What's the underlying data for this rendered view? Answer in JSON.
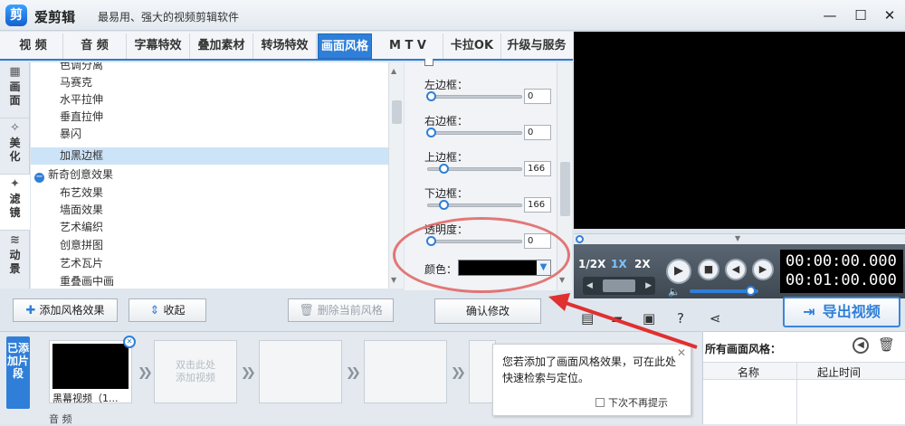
{
  "app": {
    "name": "爱剪辑",
    "slogan": "最易用、强大的视频剪辑软件"
  },
  "window_controls": {
    "minimize": "—",
    "maximize": "☐",
    "close": "✕"
  },
  "tabs": [
    {
      "label": "视 频"
    },
    {
      "label": "音 频"
    },
    {
      "label": "字幕特效"
    },
    {
      "label": "叠加素材"
    },
    {
      "label": "转场特效"
    },
    {
      "label": "画面风格",
      "active": true
    },
    {
      "label": "M T V"
    },
    {
      "label": "卡拉OK"
    },
    {
      "label": "升级与服务"
    }
  ],
  "side_tabs": [
    {
      "label": "画面",
      "icon": "picture-icon"
    },
    {
      "label": "美化",
      "icon": "magic-wand-icon"
    },
    {
      "label": "滤镜",
      "icon": "filter-icon",
      "active": true
    },
    {
      "label": "动景",
      "icon": "motion-icon"
    }
  ],
  "effect_list": [
    {
      "label": "色调分离",
      "type": "child"
    },
    {
      "label": "马赛克",
      "type": "child"
    },
    {
      "label": "水平拉伸",
      "type": "child"
    },
    {
      "label": "垂直拉伸",
      "type": "child"
    },
    {
      "label": "暴闪",
      "type": "child"
    },
    {
      "label": "加黑边框",
      "type": "child",
      "selected": true
    },
    {
      "label": "新奇创意效果",
      "type": "group"
    },
    {
      "label": "布艺效果",
      "type": "child"
    },
    {
      "label": "墙面效果",
      "type": "child"
    },
    {
      "label": "艺术编织",
      "type": "child"
    },
    {
      "label": "创意拼图",
      "type": "child"
    },
    {
      "label": "艺术瓦片",
      "type": "child"
    },
    {
      "label": "重叠画中画",
      "type": "child"
    }
  ],
  "settings": {
    "sliders": [
      {
        "label": "左边框：",
        "value": "0",
        "level": 0
      },
      {
        "label": "右边框：",
        "value": "0",
        "level": 0
      },
      {
        "label": "上边框：",
        "value": "166",
        "level": 0.15
      },
      {
        "label": "下边框：",
        "value": "166",
        "level": 0.15
      },
      {
        "label": "透明度：",
        "value": "0",
        "level": 0
      }
    ],
    "color_label": "颜色：",
    "color_value": "#000000"
  },
  "buttons": {
    "add_style": "添加风格效果",
    "collapse": "收起",
    "delete_style": "删除当前风格",
    "confirm": "确认修改"
  },
  "player": {
    "speeds": [
      "1/2X",
      "1X",
      "2X"
    ],
    "active_speed": "1X",
    "current_time": "00:00:00.000",
    "total_time": "00:01:00.000",
    "volume_level": 0.9,
    "export_label": "导出视频"
  },
  "timeline": {
    "added_label": "已添加片段",
    "clips": [
      {
        "label": "黑幕视频（1...",
        "type": "video"
      },
      {
        "label": "双击此处\n添加视频",
        "type": "empty"
      }
    ],
    "audio_label": "音 频"
  },
  "tooltip": {
    "text": "您若添加了画面风格效果，可在此处快速检索与定位。",
    "checkbox": "下次不再提示"
  },
  "right_panel": {
    "title": "所有画面风格：",
    "columns": [
      "名称",
      "起止时间"
    ]
  },
  "colors": {
    "accent": "#2f7fd8",
    "annotation": "#e06060"
  }
}
